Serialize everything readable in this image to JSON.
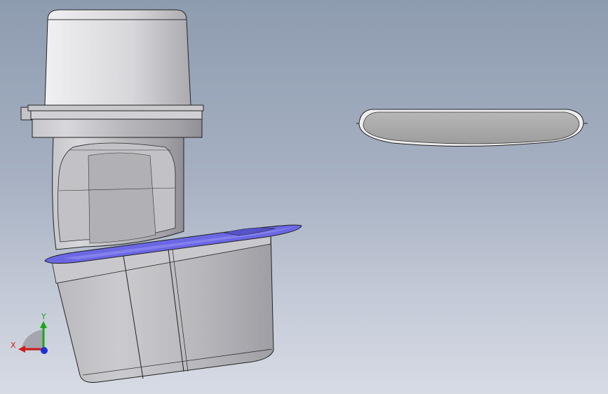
{
  "viewport": {
    "background_top": "#8e9cb0",
    "background_bottom": "#d7dbe4"
  },
  "triad": {
    "x_label": "X",
    "y_label": "Y",
    "x_color": "#d11a1a",
    "y_color": "#18a718",
    "z_color": "#1d2fd6"
  },
  "parts": {
    "part_1": "vertical-housing",
    "part_2": "cup-body",
    "part_3": "flat-disc"
  },
  "colors": {
    "body_gray": "#b9b9bd",
    "body_shadow": "#8d8d92",
    "body_highlight": "#e8e8ec",
    "disc_blue": "#6a66e2",
    "disc_top": "#a7a7a7",
    "edge": "#1f1f1f"
  }
}
